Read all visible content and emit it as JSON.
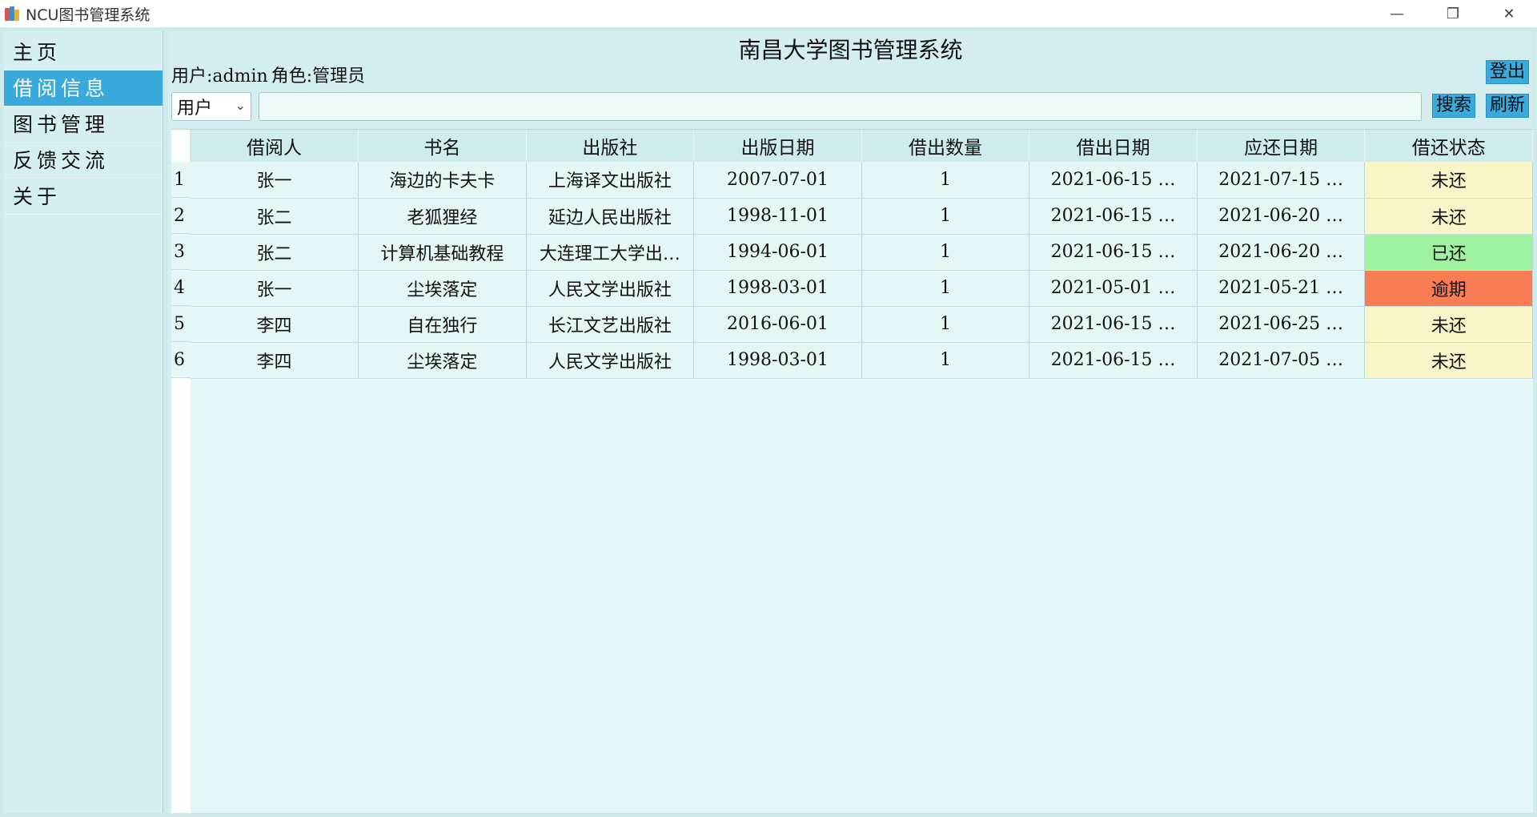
{
  "window": {
    "title": "NCU图书管理系统",
    "minimize": "—",
    "restore": "❐",
    "close": "✕"
  },
  "sidebar": {
    "items": [
      {
        "label": "主页",
        "active": false
      },
      {
        "label": "借阅信息",
        "active": true
      },
      {
        "label": "图书管理",
        "active": false
      },
      {
        "label": "反馈交流",
        "active": false
      },
      {
        "label": "关于",
        "active": false
      }
    ]
  },
  "header": {
    "title": "南昌大学图书管理系统",
    "user_label": "用户:admin",
    "role_label": "角色:管理员",
    "logout": "登出"
  },
  "search": {
    "field_selected": "用户",
    "query": "",
    "search_label": "搜索",
    "refresh_label": "刷新"
  },
  "table": {
    "columns": [
      "借阅人",
      "书名",
      "出版社",
      "出版日期",
      "借出数量",
      "借出日期",
      "应还日期",
      "借还状态"
    ],
    "rows": [
      {
        "num": "1",
        "borrower": "张一",
        "book": "海边的卡夫卡",
        "publisher": "上海译文出版社",
        "pub_date": "2007-07-01",
        "qty": "1",
        "out_date": "2021-06-15 …",
        "due_date": "2021-07-15 …",
        "status": "未还"
      },
      {
        "num": "2",
        "borrower": "张二",
        "book": "老狐狸经",
        "publisher": "延边人民出版社",
        "pub_date": "1998-11-01",
        "qty": "1",
        "out_date": "2021-06-15 …",
        "due_date": "2021-06-20 …",
        "status": "未还"
      },
      {
        "num": "3",
        "borrower": "张二",
        "book": "计算机基础教程",
        "publisher": "大连理工大学出…",
        "pub_date": "1994-06-01",
        "qty": "1",
        "out_date": "2021-06-15 …",
        "due_date": "2021-06-20 …",
        "status": "已还"
      },
      {
        "num": "4",
        "borrower": "张一",
        "book": "尘埃落定",
        "publisher": "人民文学出版社",
        "pub_date": "1998-03-01",
        "qty": "1",
        "out_date": "2021-05-01 …",
        "due_date": "2021-05-21 …",
        "status": "逾期"
      },
      {
        "num": "5",
        "borrower": "李四",
        "book": "自在独行",
        "publisher": "长江文艺出版社",
        "pub_date": "2016-06-01",
        "qty": "1",
        "out_date": "2021-06-15 …",
        "due_date": "2021-06-25 …",
        "status": "未还"
      },
      {
        "num": "6",
        "borrower": "李四",
        "book": "尘埃落定",
        "publisher": "人民文学出版社",
        "pub_date": "1998-03-01",
        "qty": "1",
        "out_date": "2021-06-15 …",
        "due_date": "2021-07-05 …",
        "status": "未还"
      }
    ]
  },
  "colors": {
    "accent": "#3aa9dc",
    "unreturned": "#f9f5c9",
    "returned": "#9ff29f",
    "overdue": "#f87d55"
  }
}
